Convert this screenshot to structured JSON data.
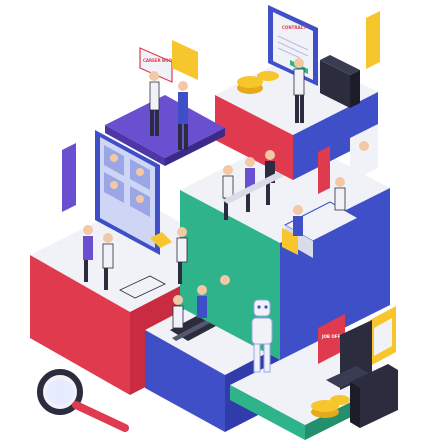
{
  "scene": {
    "description_labels": {
      "sign_text": "CAREER BOOK",
      "contract_text": "CONTRACT",
      "board_text": "JOB OFFER"
    },
    "palette": {
      "red": "#e03a4e",
      "blue": "#3f4fc8",
      "green": "#2fb38a",
      "purple": "#6a4fd0",
      "yellow": "#f7c52c",
      "white_top": "#f1f2f8",
      "shadow_side": "#d9dbe8",
      "dark": "#2b2c3e"
    },
    "icons": [
      "magnifier-icon",
      "briefcase-icon",
      "coin-stack-icon",
      "document-icon",
      "chair-icon",
      "robot-icon",
      "tablet-icon",
      "conveyor-belt-icon"
    ]
  }
}
